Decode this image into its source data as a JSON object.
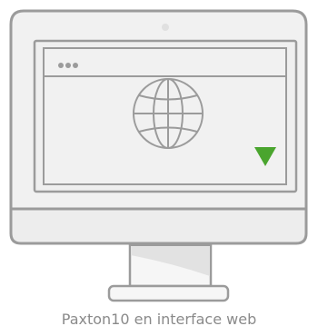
{
  "caption": "Paxton10 en interface web",
  "colors": {
    "outline": "#9b9b9b",
    "monitor_face": "#f1f1f1",
    "window_fill": "#efefef",
    "accent_triangle": "#4aa52e",
    "background": "#ffffff"
  },
  "icons": {
    "camera": "webcam-dot",
    "window_controls": "three-dots",
    "globe": "globe-icon",
    "indicator": "down-triangle"
  }
}
